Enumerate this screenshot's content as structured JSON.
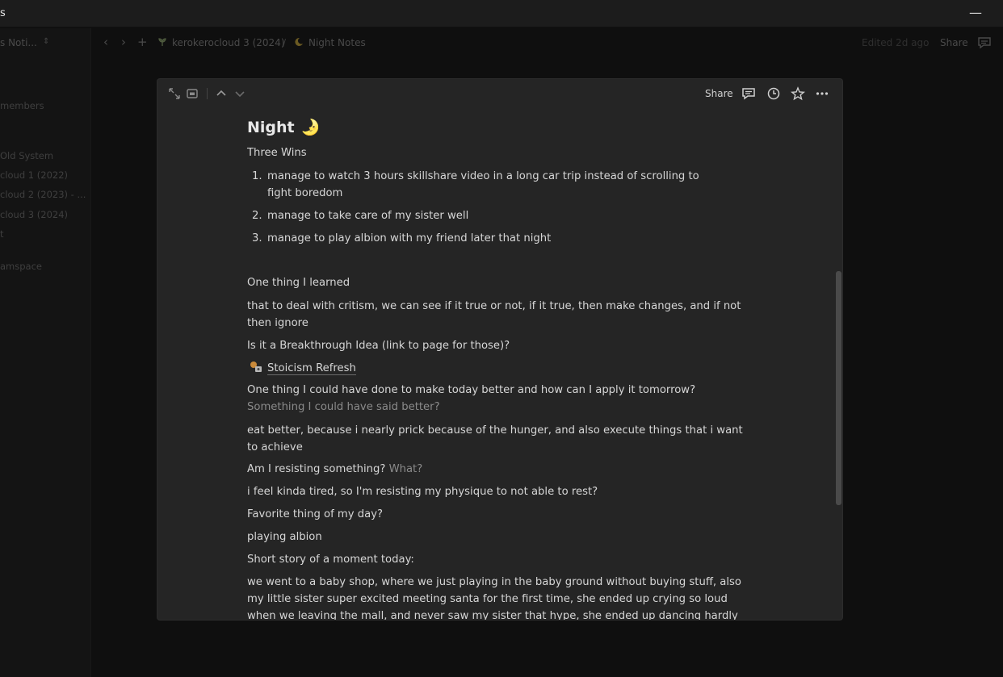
{
  "window": {
    "title": "s",
    "minimize_label": "—"
  },
  "sidebar": {
    "workspace_name": "s Noti...",
    "items": [
      {
        "label": "members"
      },
      {
        "label": "Old System"
      },
      {
        "label": "cloud 1 (2022)"
      },
      {
        "label": "cloud 2 (2023) - ..."
      },
      {
        "label": "cloud 3 (2024)"
      },
      {
        "label": "t"
      },
      {
        "label": "amspace"
      }
    ]
  },
  "topbar": {
    "breadcrumb": [
      {
        "icon": "sprout-icon",
        "label": "kerokerocloud 3 (2024)"
      },
      {
        "icon": "moon-icon",
        "label": "Night Notes"
      }
    ],
    "separator": "/",
    "edited": "Edited 2d ago",
    "share_label": "Share"
  },
  "modal": {
    "share_label": "Share",
    "title": "Night",
    "title_emoji": "🌛",
    "heading_wins": "Three Wins",
    "wins": [
      {
        "num": "1.",
        "text": "manage to watch 3 hours skillshare video in a long car trip instead of scrolling to fight boredom"
      },
      {
        "num": "2.",
        "text": "manage to take care of my sister well"
      },
      {
        "num": "3.",
        "text": "manage to play albion with my friend later that night"
      }
    ],
    "q_learned": "One thing I learned",
    "a_learned": "that to deal with critism, we can see if it true or not, if it true, then make changes, and if not then ignore",
    "q_breakthrough": "Is it a Breakthrough Idea (link to page for those)?",
    "link_label": "Stoicism Refresh",
    "q_better": "One thing I could have done to make today better and how can I apply it tomorrow?",
    "q_better_sub": "Something I could have said better?",
    "a_better": "eat better, because i nearly prick because of the hunger, and also execute things that i want to achieve",
    "q_resist": "Am I resisting something?",
    "q_resist_sub": "What?",
    "a_resist": "i feel kinda tired, so I'm resisting my physique to not able to rest?",
    "q_favorite": "Favorite thing of my day?",
    "a_favorite": "playing albion",
    "q_story": "Short story of a moment today:",
    "a_story": "we went to a baby shop, where we just playing in the baby ground without buying stuff, also my little sister super excited meeting santa for the first time, she ended up crying so loud when we leaving the mall, and never saw my sister that hype, she ended up dancing hardly in public, and"
  },
  "colors": {
    "page_bg": "#0f0f0f",
    "modal_bg": "#252525",
    "text": "#d6d6d6",
    "muted": "#8a8a8a"
  }
}
